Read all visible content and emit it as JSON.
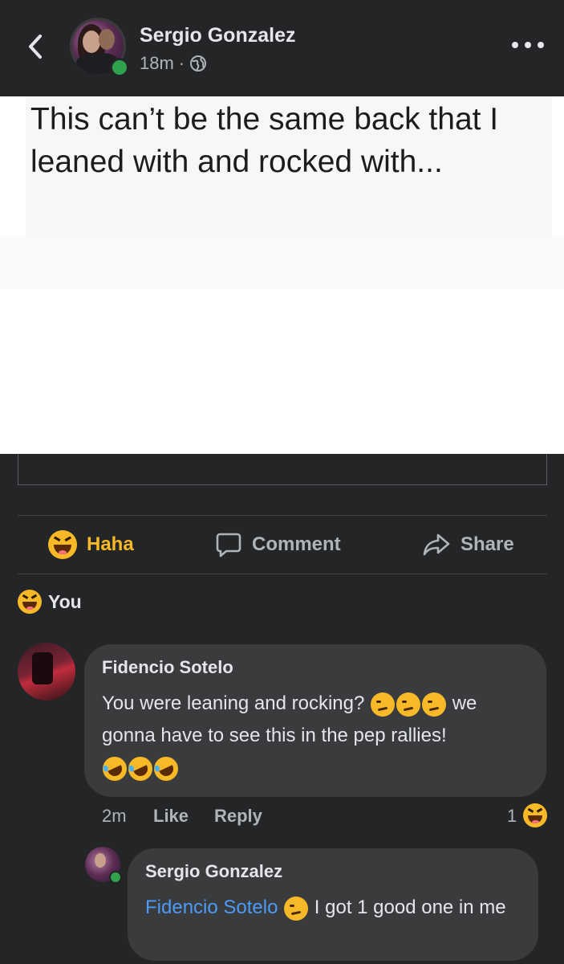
{
  "header": {
    "poster_name": "Sergio Gonzalez",
    "time": "18m",
    "separator": "·",
    "privacy_icon": "globe-icon"
  },
  "post": {
    "meme_text": "This can’t be the same back that I leaned with and rocked with..."
  },
  "actions": {
    "haha_label": "Haha",
    "comment_label": "Comment",
    "share_label": "Share"
  },
  "reactions": {
    "reactor": "You"
  },
  "comments": [
    {
      "author": "Fidencio Sotelo",
      "text_part1": "You were leaning and rocking?",
      "text_part2": "we gonna have to see this in the pep rallies!",
      "time": "2m",
      "like_label": "Like",
      "reply_label": "Reply",
      "reaction_count": "1"
    },
    {
      "author": "Sergio Gonzalez",
      "mention": "Fidencio Sotelo",
      "text": "I got 1 good one in me"
    }
  ],
  "colors": {
    "background": "#242526",
    "bubble": "#3a3b3c",
    "haha": "#f7b928",
    "mention": "#4d9af8",
    "online": "#31a24c"
  }
}
